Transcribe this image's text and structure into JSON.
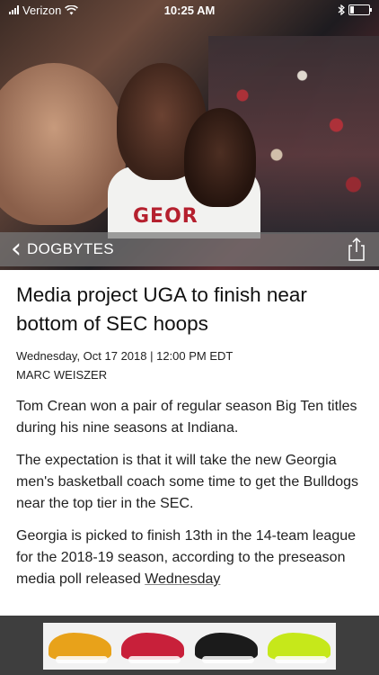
{
  "status_bar": {
    "carrier": "Verizon",
    "time": "10:25 AM",
    "battery_level": 0.2
  },
  "nav": {
    "back_label": "DOGBYTES"
  },
  "article": {
    "headline": "Media project UGA to finish near bottom of SEC hoops",
    "dateline": "Wednesday, Oct 17 2018 | 12:00 PM EDT",
    "author": "MARC WEISZER",
    "p1": "Tom Crean won a pair of regular season Big Ten titles during his nine seasons at Indiana.",
    "p2": "The expectation is that it will take the new Georgia men's basketball coach some time to get the Bulldogs near the top tier in the SEC.",
    "p3_before_link": "Georgia is picked to finish 13th in the 14-team league for the 2018-19 season, according to the preseason media poll released ",
    "p3_link": "Wednesday"
  },
  "hero": {
    "jersey_text": "GEOR"
  },
  "ad": {
    "shoe_colors": [
      "#e8a21a",
      "#c8203a",
      "#1b1b1b",
      "#c6e81a"
    ]
  },
  "icons": {
    "wifi": "wifi-icon",
    "bluetooth": "bluetooth-icon",
    "share": "share-icon",
    "back": "chevron-left-icon"
  }
}
